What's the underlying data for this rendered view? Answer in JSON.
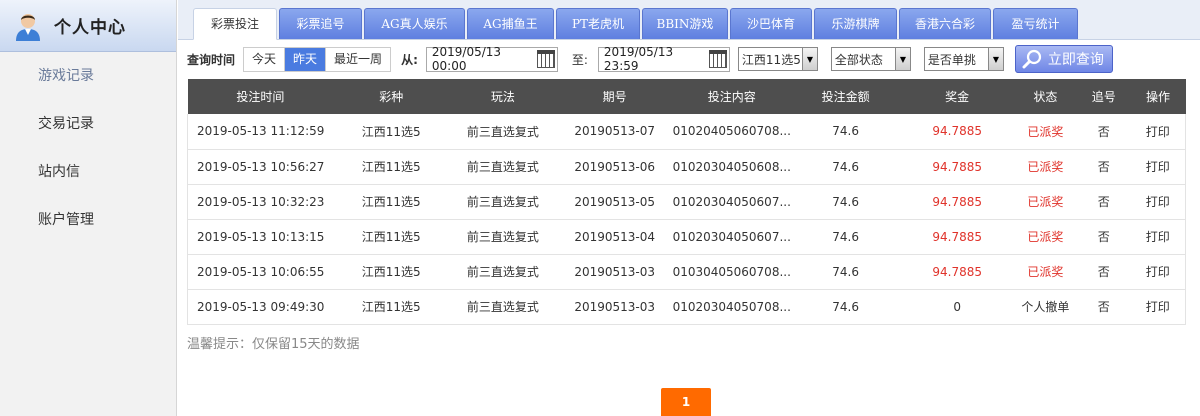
{
  "sidebar": {
    "title": "个人中心",
    "items": [
      {
        "label": "游戏记录"
      },
      {
        "label": "交易记录"
      },
      {
        "label": "站内信"
      },
      {
        "label": "账户管理"
      }
    ]
  },
  "tabs": [
    {
      "label": "彩票投注"
    },
    {
      "label": "彩票追号"
    },
    {
      "label": "AG真人娱乐"
    },
    {
      "label": "AG捕鱼王"
    },
    {
      "label": "PT老虎机"
    },
    {
      "label": "BBIN游戏"
    },
    {
      "label": "沙巴体育"
    },
    {
      "label": "乐游棋牌"
    },
    {
      "label": "香港六合彩"
    },
    {
      "label": "盈亏统计"
    }
  ],
  "query": {
    "time_label": "查询时间",
    "range_buttons": [
      {
        "label": "今天"
      },
      {
        "label": "昨天"
      },
      {
        "label": "最近一周"
      }
    ],
    "from_label": "从:",
    "from_value": "2019/05/13 00:00",
    "to_label": "至:",
    "to_value": "2019/05/13 23:59",
    "lottery_select": "江西11选5",
    "status_select": "全部状态",
    "single_select": "是否单挑",
    "submit_label": "立即查询"
  },
  "table": {
    "headers": [
      "投注时间",
      "彩种",
      "玩法",
      "期号",
      "投注内容",
      "投注金额",
      "奖金",
      "状态",
      "追号",
      "操作"
    ],
    "rows": [
      [
        "2019-05-13 11:12:59",
        "江西11选5",
        "前三直选复式",
        "20190513-07",
        "01020405060708...",
        "74.6",
        "94.7885",
        "已派奖",
        "否",
        "打印"
      ],
      [
        "2019-05-13 10:56:27",
        "江西11选5",
        "前三直选复式",
        "20190513-06",
        "01020304050608...",
        "74.6",
        "94.7885",
        "已派奖",
        "否",
        "打印"
      ],
      [
        "2019-05-13 10:32:23",
        "江西11选5",
        "前三直选复式",
        "20190513-05",
        "01020304050607...",
        "74.6",
        "94.7885",
        "已派奖",
        "否",
        "打印"
      ],
      [
        "2019-05-13 10:13:15",
        "江西11选5",
        "前三直选复式",
        "20190513-04",
        "01020304050607...",
        "74.6",
        "94.7885",
        "已派奖",
        "否",
        "打印"
      ],
      [
        "2019-05-13 10:06:55",
        "江西11选5",
        "前三直选复式",
        "20190513-03",
        "01030405060708...",
        "74.6",
        "94.7885",
        "已派奖",
        "否",
        "打印"
      ],
      [
        "2019-05-13 09:49:30",
        "江西11选5",
        "前三直选复式",
        "20190513-03",
        "01020304050708...",
        "74.6",
        "0",
        "个人撤单",
        "否",
        "打印"
      ]
    ]
  },
  "tip": "温馨提示：仅保留15天的数据",
  "pager": {
    "current": "1"
  },
  "colors": {
    "accent": "#4a7be0",
    "header_bg": "#4e4e4e",
    "prize_red": "#e0332b",
    "pager_orange": "#ff6a00"
  }
}
